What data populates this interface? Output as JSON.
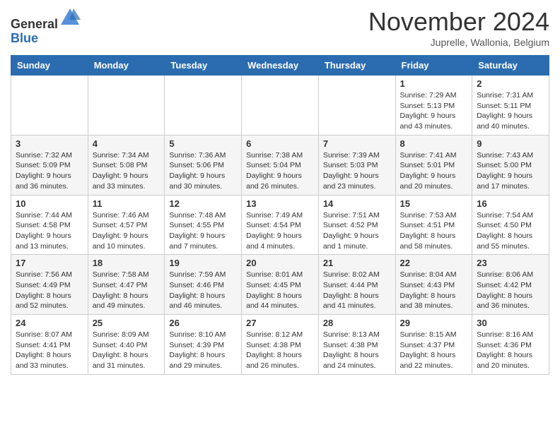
{
  "header": {
    "logo_general": "General",
    "logo_blue": "Blue",
    "month_title": "November 2024",
    "location": "Juprelle, Wallonia, Belgium"
  },
  "calendar": {
    "days_of_week": [
      "Sunday",
      "Monday",
      "Tuesday",
      "Wednesday",
      "Thursday",
      "Friday",
      "Saturday"
    ],
    "weeks": [
      [
        {
          "day": "",
          "info": ""
        },
        {
          "day": "",
          "info": ""
        },
        {
          "day": "",
          "info": ""
        },
        {
          "day": "",
          "info": ""
        },
        {
          "day": "",
          "info": ""
        },
        {
          "day": "1",
          "info": "Sunrise: 7:29 AM\nSunset: 5:13 PM\nDaylight: 9 hours\nand 43 minutes."
        },
        {
          "day": "2",
          "info": "Sunrise: 7:31 AM\nSunset: 5:11 PM\nDaylight: 9 hours\nand 40 minutes."
        }
      ],
      [
        {
          "day": "3",
          "info": "Sunrise: 7:32 AM\nSunset: 5:09 PM\nDaylight: 9 hours\nand 36 minutes."
        },
        {
          "day": "4",
          "info": "Sunrise: 7:34 AM\nSunset: 5:08 PM\nDaylight: 9 hours\nand 33 minutes."
        },
        {
          "day": "5",
          "info": "Sunrise: 7:36 AM\nSunset: 5:06 PM\nDaylight: 9 hours\nand 30 minutes."
        },
        {
          "day": "6",
          "info": "Sunrise: 7:38 AM\nSunset: 5:04 PM\nDaylight: 9 hours\nand 26 minutes."
        },
        {
          "day": "7",
          "info": "Sunrise: 7:39 AM\nSunset: 5:03 PM\nDaylight: 9 hours\nand 23 minutes."
        },
        {
          "day": "8",
          "info": "Sunrise: 7:41 AM\nSunset: 5:01 PM\nDaylight: 9 hours\nand 20 minutes."
        },
        {
          "day": "9",
          "info": "Sunrise: 7:43 AM\nSunset: 5:00 PM\nDaylight: 9 hours\nand 17 minutes."
        }
      ],
      [
        {
          "day": "10",
          "info": "Sunrise: 7:44 AM\nSunset: 4:58 PM\nDaylight: 9 hours\nand 13 minutes."
        },
        {
          "day": "11",
          "info": "Sunrise: 7:46 AM\nSunset: 4:57 PM\nDaylight: 9 hours\nand 10 minutes."
        },
        {
          "day": "12",
          "info": "Sunrise: 7:48 AM\nSunset: 4:55 PM\nDaylight: 9 hours\nand 7 minutes."
        },
        {
          "day": "13",
          "info": "Sunrise: 7:49 AM\nSunset: 4:54 PM\nDaylight: 9 hours\nand 4 minutes."
        },
        {
          "day": "14",
          "info": "Sunrise: 7:51 AM\nSunset: 4:52 PM\nDaylight: 9 hours\nand 1 minute."
        },
        {
          "day": "15",
          "info": "Sunrise: 7:53 AM\nSunset: 4:51 PM\nDaylight: 8 hours\nand 58 minutes."
        },
        {
          "day": "16",
          "info": "Sunrise: 7:54 AM\nSunset: 4:50 PM\nDaylight: 8 hours\nand 55 minutes."
        }
      ],
      [
        {
          "day": "17",
          "info": "Sunrise: 7:56 AM\nSunset: 4:49 PM\nDaylight: 8 hours\nand 52 minutes."
        },
        {
          "day": "18",
          "info": "Sunrise: 7:58 AM\nSunset: 4:47 PM\nDaylight: 8 hours\nand 49 minutes."
        },
        {
          "day": "19",
          "info": "Sunrise: 7:59 AM\nSunset: 4:46 PM\nDaylight: 8 hours\nand 46 minutes."
        },
        {
          "day": "20",
          "info": "Sunrise: 8:01 AM\nSunset: 4:45 PM\nDaylight: 8 hours\nand 44 minutes."
        },
        {
          "day": "21",
          "info": "Sunrise: 8:02 AM\nSunset: 4:44 PM\nDaylight: 8 hours\nand 41 minutes."
        },
        {
          "day": "22",
          "info": "Sunrise: 8:04 AM\nSunset: 4:43 PM\nDaylight: 8 hours\nand 38 minutes."
        },
        {
          "day": "23",
          "info": "Sunrise: 8:06 AM\nSunset: 4:42 PM\nDaylight: 8 hours\nand 36 minutes."
        }
      ],
      [
        {
          "day": "24",
          "info": "Sunrise: 8:07 AM\nSunset: 4:41 PM\nDaylight: 8 hours\nand 33 minutes."
        },
        {
          "day": "25",
          "info": "Sunrise: 8:09 AM\nSunset: 4:40 PM\nDaylight: 8 hours\nand 31 minutes."
        },
        {
          "day": "26",
          "info": "Sunrise: 8:10 AM\nSunset: 4:39 PM\nDaylight: 8 hours\nand 29 minutes."
        },
        {
          "day": "27",
          "info": "Sunrise: 8:12 AM\nSunset: 4:38 PM\nDaylight: 8 hours\nand 26 minutes."
        },
        {
          "day": "28",
          "info": "Sunrise: 8:13 AM\nSunset: 4:38 PM\nDaylight: 8 hours\nand 24 minutes."
        },
        {
          "day": "29",
          "info": "Sunrise: 8:15 AM\nSunset: 4:37 PM\nDaylight: 8 hours\nand 22 minutes."
        },
        {
          "day": "30",
          "info": "Sunrise: 8:16 AM\nSunset: 4:36 PM\nDaylight: 8 hours\nand 20 minutes."
        }
      ]
    ]
  }
}
